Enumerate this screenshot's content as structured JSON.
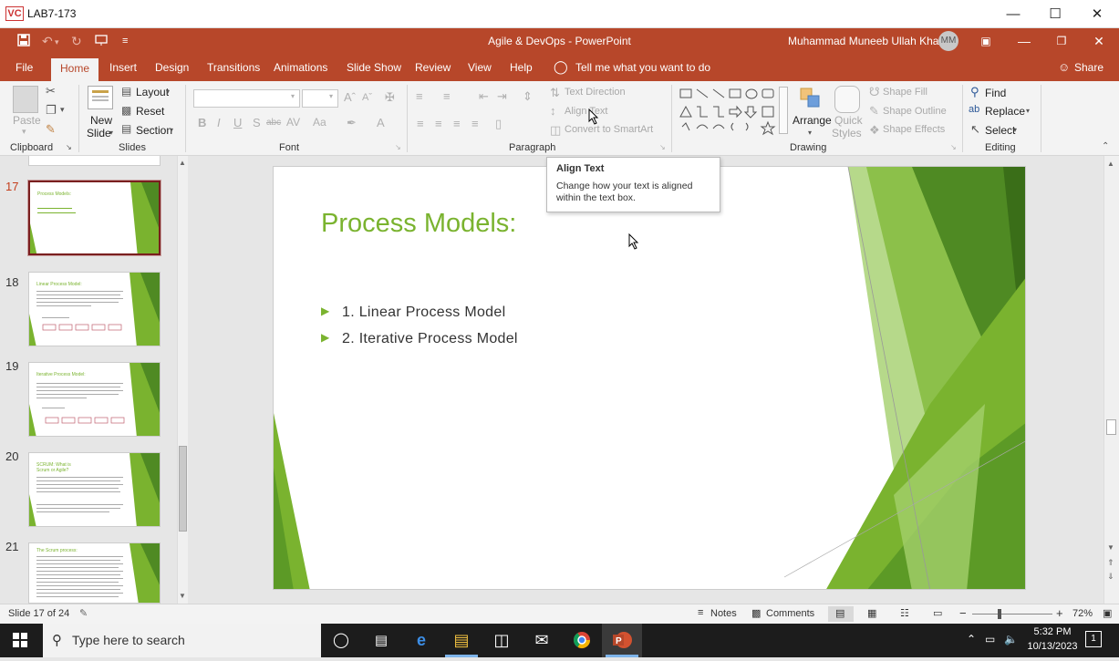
{
  "window": {
    "title": "LAB7-173",
    "logo": "VC"
  },
  "titlebar": {
    "document": "Agile & DevOps  -  PowerPoint",
    "user": "Muhammad Muneeb Ullah Khan",
    "initials": "MM"
  },
  "tabs": [
    "File",
    "Home",
    "Insert",
    "Design",
    "Transitions",
    "Animations",
    "Slide Show",
    "Review",
    "View",
    "Help"
  ],
  "tell_me": "Tell me what you want to do",
  "share": "Share",
  "ribbon": {
    "clipboard": {
      "label": "Clipboard",
      "paste": "Paste"
    },
    "slides": {
      "label": "Slides",
      "new_slide_1": "New",
      "new_slide_2": "Slide",
      "layout": "Layout",
      "reset": "Reset",
      "section": "Section"
    },
    "font": {
      "label": "Font"
    },
    "paragraph": {
      "label": "Paragraph",
      "text_direction": "Text Direction",
      "align_text": "Align Text",
      "convert": "Convert to SmartArt"
    },
    "drawing": {
      "label": "Drawing",
      "arrange": "Arrange",
      "quick_1": "Quick",
      "quick_2": "Styles",
      "fill": "Shape Fill",
      "outline": "Shape Outline",
      "effects": "Shape Effects"
    },
    "editing": {
      "label": "Editing",
      "find": "Find",
      "replace": "Replace",
      "select": "Select"
    }
  },
  "tooltip": {
    "title": "Align Text",
    "body": "Change how your text is aligned within the text box."
  },
  "thumbnails": [
    {
      "number": "17",
      "title": "Process Models:"
    },
    {
      "number": "18",
      "title": "Linear Process Model:"
    },
    {
      "number": "19",
      "title": "Iterative Process Model:"
    },
    {
      "number": "20",
      "title": "SCRUM: What is Scrum or Agile?"
    },
    {
      "number": "21",
      "title": "The Scrum process:"
    }
  ],
  "slide": {
    "title": "Process Models:",
    "bullets": [
      "1. Linear Process Model",
      "2. Iterative Process Model"
    ],
    "accent": "#7ab32f"
  },
  "status": {
    "slide_of": "Slide 17 of 24",
    "notes": "Notes",
    "comments": "Comments",
    "zoom": "72%"
  },
  "taskbar": {
    "search_placeholder": "Type here to search",
    "time": "5:32 PM",
    "date": "10/13/2023",
    "notifications": "1"
  }
}
